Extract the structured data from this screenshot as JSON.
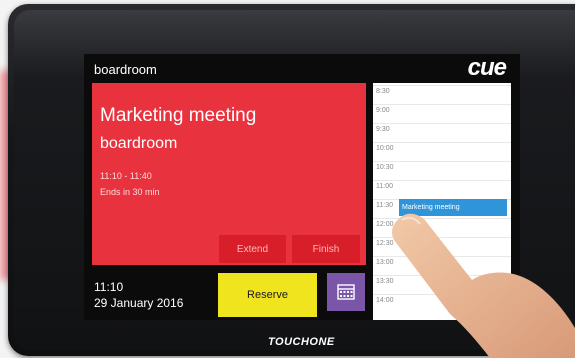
{
  "header": {
    "room": "boardroom",
    "logo": "cue"
  },
  "meeting": {
    "title": "Marketing meeting",
    "room": "boardroom",
    "time": "11:10 - 11:40",
    "ends": "Ends in 30 min",
    "extend_label": "Extend",
    "finish_label": "Finish"
  },
  "status": {
    "time": "11:10",
    "date": "29 January 2016"
  },
  "actions": {
    "reserve_label": "Reserve",
    "calendar_icon": "calendar-icon"
  },
  "schedule": {
    "slots": [
      "8:30",
      "9:00",
      "9:30",
      "10:00",
      "10:30",
      "11:00",
      "11:30",
      "12:00",
      "12:30",
      "13:00",
      "13:30",
      "14:00"
    ],
    "event": "Marketing meeting"
  },
  "device": {
    "brand": "TOUCHONE"
  },
  "colors": {
    "meeting_red": "#e8333f",
    "button_red": "#d81e29",
    "reserve_yellow": "#f0e41e",
    "calendar_purple": "#7a55a8",
    "event_blue": "#2f95d8"
  }
}
